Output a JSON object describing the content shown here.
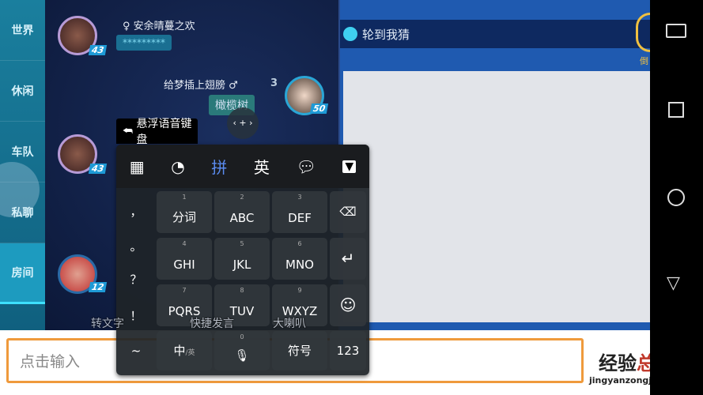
{
  "sidebar": {
    "tabs": [
      "世界",
      "休闲",
      "车队",
      "私聊",
      "房间"
    ],
    "active": "房间"
  },
  "chat": {
    "messages": [
      {
        "name": "安余晴蔓之欢",
        "text": "*********",
        "level": "43",
        "gender": "female"
      },
      {
        "name": "给梦插上翅膀",
        "text": "橄榄树",
        "level": "50",
        "gender": "male",
        "rank": "3"
      },
      {
        "name": "",
        "text": "",
        "level": "43"
      },
      {
        "name": "",
        "text": "",
        "level": "12"
      }
    ],
    "actions": [
      "转文字",
      "快捷发言",
      "大喇叭"
    ]
  },
  "game": {
    "turn_label": "轮到我猜",
    "timer_label": "倒"
  },
  "input": {
    "placeholder": "点击输入"
  },
  "keyboard": {
    "tooltip": "悬浮语音键盘",
    "toolbar": [
      "grid-icon",
      "pacman-icon",
      "拼",
      "英",
      "chat-bubble-icon",
      "collapse-icon"
    ],
    "active_mode": "拼",
    "symbols": [
      "，",
      "。",
      "？",
      "！",
      "~"
    ],
    "keys": [
      {
        "num": "1",
        "label": "分词"
      },
      {
        "num": "2",
        "label": "ABC"
      },
      {
        "num": "3",
        "label": "DEF"
      },
      {
        "num": "4",
        "label": "GHI"
      },
      {
        "num": "5",
        "label": "JKL"
      },
      {
        "num": "6",
        "label": "MNO"
      },
      {
        "num": "7",
        "label": "PQRS"
      },
      {
        "num": "8",
        "label": "TUV"
      },
      {
        "num": "9",
        "label": "WXYZ"
      }
    ],
    "bottom": {
      "lang": "中",
      "lang_sub": "/英",
      "space_num": "0",
      "symbols": "符号",
      "numbers": "123"
    },
    "accent": "#5b8cf0"
  },
  "watermark": {
    "line1a": "经验",
    "line1b": "总结",
    "line2": "jingyanzongjie.com"
  },
  "colors": {
    "input_border": "#ef9a3c",
    "sidebar_active": "#1d9bbf"
  }
}
